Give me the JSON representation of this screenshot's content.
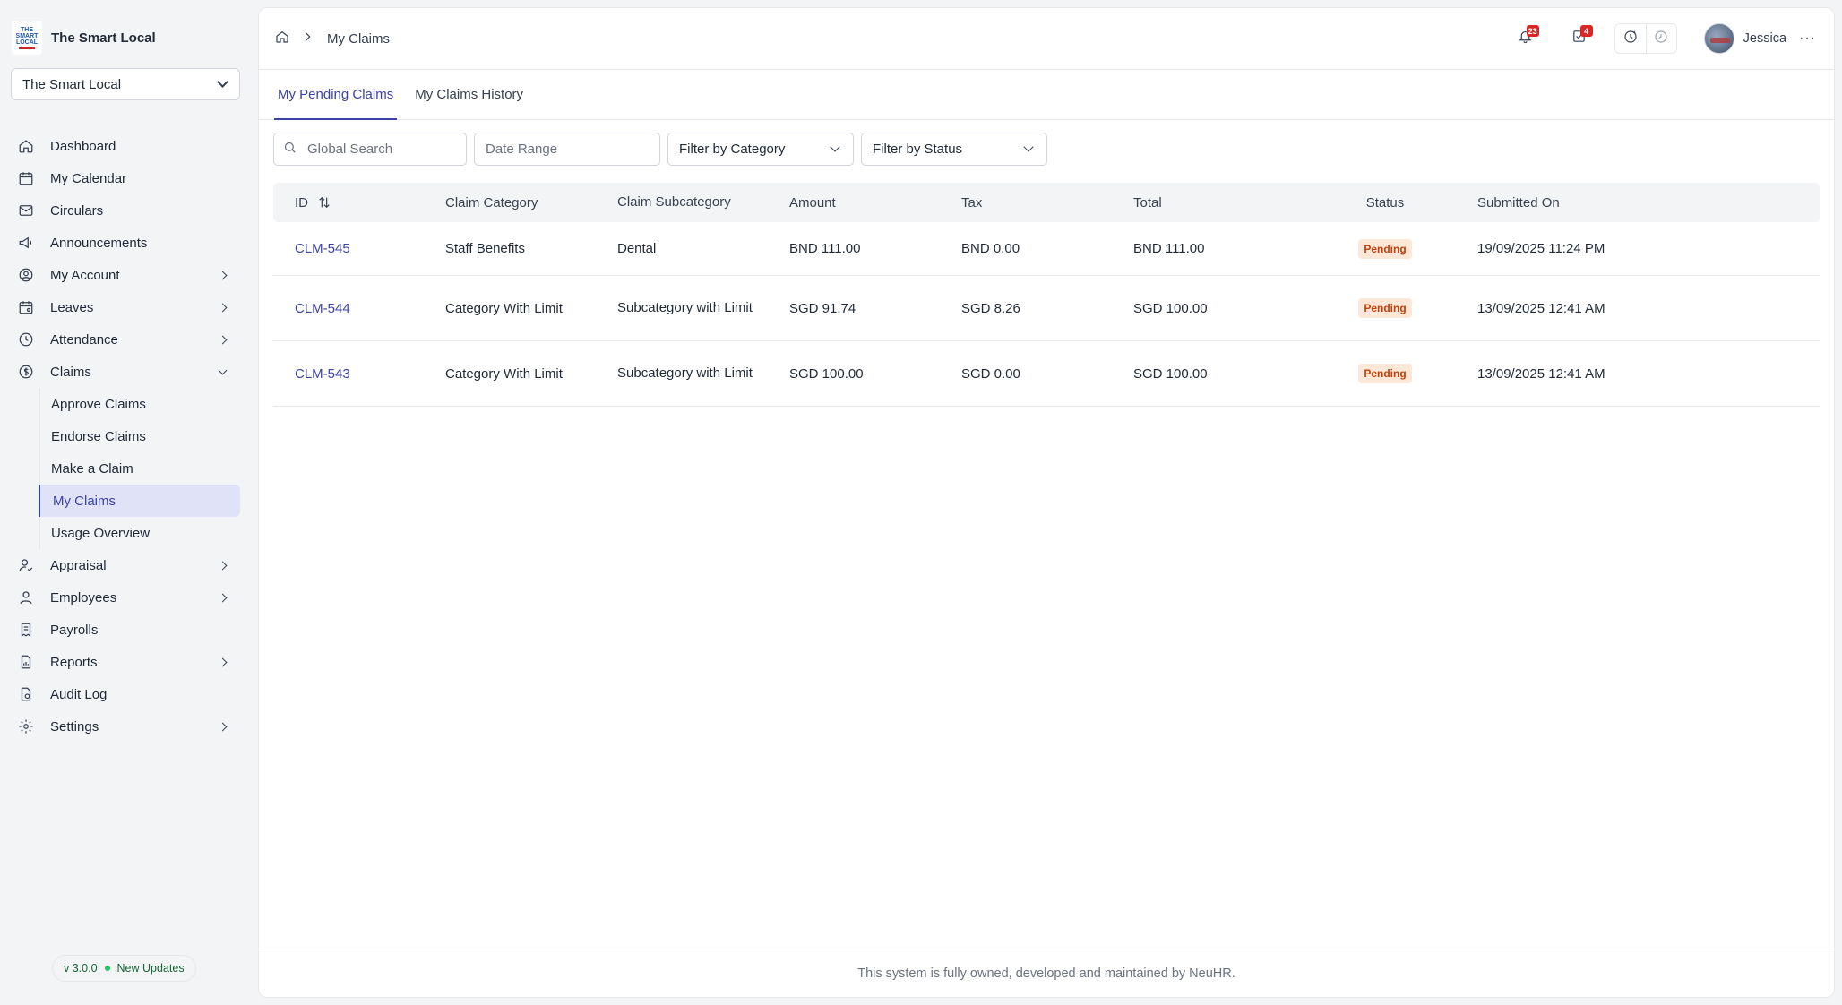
{
  "brand": {
    "name": "The Smart Local",
    "logo_text": "THE SMART LOCAL"
  },
  "org_select": {
    "value": "The Smart Local"
  },
  "sidebar": {
    "items": [
      {
        "label": "Dashboard",
        "icon": "home-icon"
      },
      {
        "label": "My Calendar",
        "icon": "calendar-icon"
      },
      {
        "label": "Circulars",
        "icon": "mail-icon"
      },
      {
        "label": "Announcements",
        "icon": "megaphone-icon"
      },
      {
        "label": "My Account",
        "icon": "user-circle-icon"
      },
      {
        "label": "Leaves",
        "icon": "calendar-leave-icon"
      },
      {
        "label": "Attendance",
        "icon": "clock-icon"
      },
      {
        "label": "Claims",
        "icon": "dollar-icon"
      }
    ],
    "claims_sub": [
      {
        "label": "Approve Claims"
      },
      {
        "label": "Endorse Claims"
      },
      {
        "label": "Make a Claim"
      },
      {
        "label": "My Claims"
      },
      {
        "label": "Usage Overview"
      }
    ],
    "items_after": [
      {
        "label": "Appraisal",
        "icon": "user-check-icon"
      },
      {
        "label": "Employees",
        "icon": "user-icon"
      },
      {
        "label": "Payrolls",
        "icon": "receipt-icon"
      },
      {
        "label": "Reports",
        "icon": "file-chart-icon"
      },
      {
        "label": "Audit Log",
        "icon": "file-log-icon"
      },
      {
        "label": "Settings",
        "icon": "gear-icon"
      }
    ]
  },
  "version": {
    "number": "v 3.0.0",
    "updates": "New Updates"
  },
  "breadcrumb": {
    "current": "My Claims"
  },
  "header": {
    "notifications_count": "23",
    "tasks_count": "4",
    "user_name": "Jessica"
  },
  "tabs": [
    {
      "label": "My Pending Claims"
    },
    {
      "label": "My Claims History"
    }
  ],
  "filters": {
    "search_placeholder": "Global Search",
    "date_placeholder": "Date Range",
    "category": "Filter by Category",
    "status": "Filter by Status"
  },
  "table": {
    "headers": [
      "ID",
      "Claim Category",
      "Claim Subcategory",
      "Amount",
      "Tax",
      "Total",
      "Status",
      "Submitted On"
    ],
    "rows": [
      {
        "id": "CLM-545",
        "category": "Staff Benefits",
        "subcategory": "Dental",
        "amount": "BND 111.00",
        "tax": "BND 0.00",
        "total": "BND 111.00",
        "status": "Pending",
        "submitted": "19/09/2025 11:24 PM"
      },
      {
        "id": "CLM-544",
        "category": "Category With Limit",
        "subcategory": "Subcategory with Limit",
        "amount": "SGD 91.74",
        "tax": "SGD 8.26",
        "total": "SGD 100.00",
        "status": "Pending",
        "submitted": "13/09/2025 12:41 AM"
      },
      {
        "id": "CLM-543",
        "category": "Category With Limit",
        "subcategory": "Subcategory with Limit",
        "amount": "SGD 100.00",
        "tax": "SGD 0.00",
        "total": "SGD 100.00",
        "status": "Pending",
        "submitted": "13/09/2025 12:41 AM"
      }
    ]
  },
  "footer": {
    "text": "This system is fully owned, developed and maintained by NeuHR."
  },
  "colors": {
    "accent": "#3b42a6",
    "pending_bg": "#fde8d8",
    "pending_text": "#c2410c",
    "badge": "#dc2626"
  }
}
